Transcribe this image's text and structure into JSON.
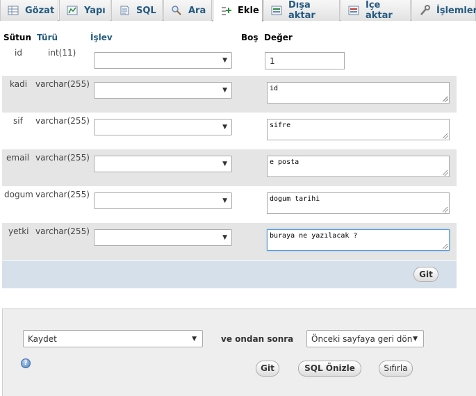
{
  "tabs": [
    {
      "label": "Gözat",
      "icon": "browse-table-icon"
    },
    {
      "label": "Yapı",
      "icon": "structure-icon"
    },
    {
      "label": "SQL",
      "icon": "sql-icon"
    },
    {
      "label": "Ara",
      "icon": "search-icon"
    },
    {
      "label": "Ekle",
      "icon": "insert-icon"
    },
    {
      "label": "Dışa aktar",
      "icon": "export-icon"
    },
    {
      "label": "İçe aktar",
      "icon": "import-icon"
    },
    {
      "label": "İşlemler",
      "icon": "operations-icon"
    }
  ],
  "active_tab": "Ekle",
  "headers": {
    "column": "Sütun",
    "type": "Türü",
    "function": "İşlev",
    "null": "Boş",
    "value": "Değer"
  },
  "rows": [
    {
      "name": "id",
      "type": "int(11)",
      "value": "1"
    },
    {
      "name": "kadi",
      "type": "varchar(255)",
      "value": "id"
    },
    {
      "name": "sif",
      "type": "varchar(255)",
      "value": "sifre"
    },
    {
      "name": "email",
      "type": "varchar(255)",
      "value": "e posta"
    },
    {
      "name": "dogum",
      "type": "varchar(255)",
      "value": "dogum tarihi"
    },
    {
      "name": "yetki",
      "type": "varchar(255)",
      "value": "buraya ne yazılacak ?"
    }
  ],
  "go_label": "Git",
  "bottom": {
    "action_select": "Kaydet",
    "then_label": "ve ondan sonra",
    "after_select": "Önceki sayfaya geri dön",
    "go_label": "Git",
    "preview_label": "SQL Önizle",
    "reset_label": "Sıfırla",
    "help_icon": "help-icon"
  },
  "colors": {
    "accent": "#235a81",
    "row_alt": "#e5e5e5",
    "go_bar": "#d6e0eb",
    "panel": "#eeeeee"
  }
}
